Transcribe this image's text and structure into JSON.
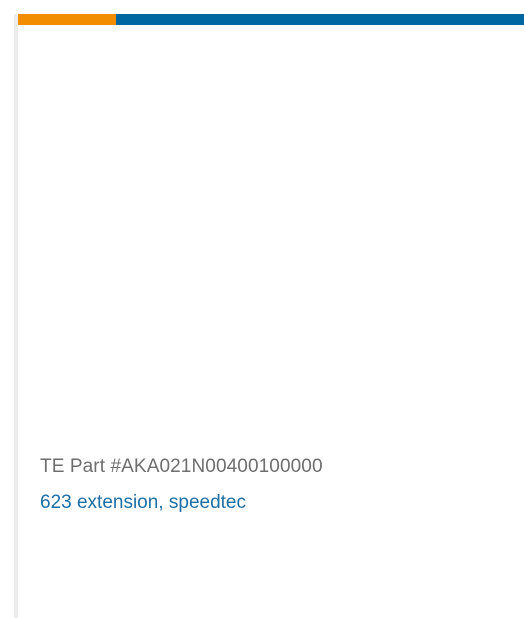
{
  "product_card": {
    "part_number": "TE Part #AKA021N00400100000",
    "name": "623 extension, speedtec",
    "colors": {
      "accent_orange": "#f28c00",
      "accent_blue": "#0067a0",
      "part_number_text": "#6e6e6e",
      "link_text": "#1d6fa5"
    }
  }
}
